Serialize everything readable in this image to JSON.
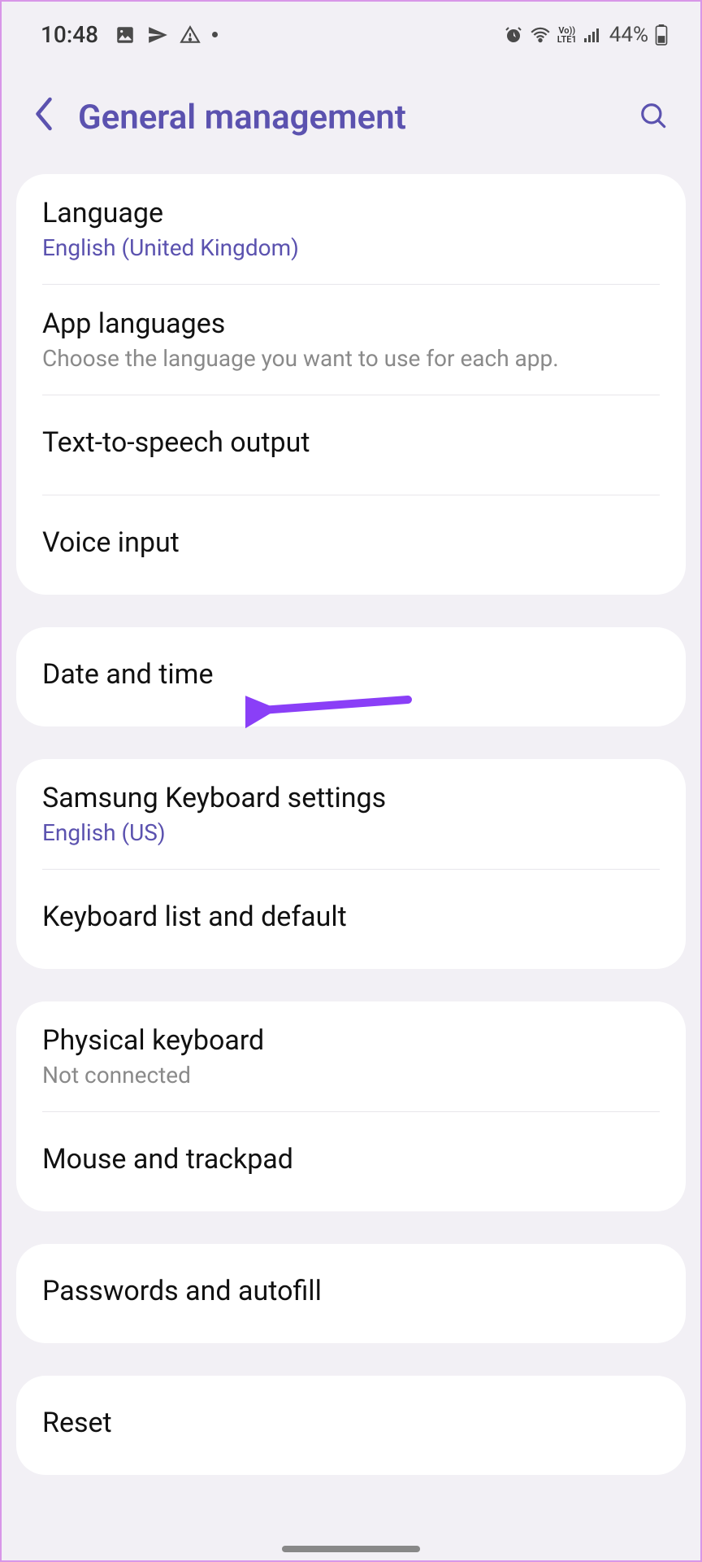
{
  "status_bar": {
    "time": "10:48",
    "battery": "44%"
  },
  "header": {
    "title": "General management"
  },
  "groups": [
    {
      "items": [
        {
          "title": "Language",
          "sub": "English (United Kingdom)",
          "sub_style": "accent"
        },
        {
          "title": "App languages",
          "sub": "Choose the language you want to use for each app.",
          "sub_style": "muted"
        },
        {
          "title": "Text-to-speech output"
        },
        {
          "title": "Voice input"
        }
      ]
    },
    {
      "items": [
        {
          "title": "Date and time"
        }
      ]
    },
    {
      "items": [
        {
          "title": "Samsung Keyboard settings",
          "sub": "English (US)",
          "sub_style": "accent"
        },
        {
          "title": "Keyboard list and default"
        }
      ]
    },
    {
      "items": [
        {
          "title": "Physical keyboard",
          "sub": "Not connected",
          "sub_style": "muted"
        },
        {
          "title": "Mouse and trackpad"
        }
      ]
    },
    {
      "items": [
        {
          "title": "Passwords and autofill"
        }
      ]
    },
    {
      "items": [
        {
          "title": "Reset"
        }
      ]
    }
  ]
}
